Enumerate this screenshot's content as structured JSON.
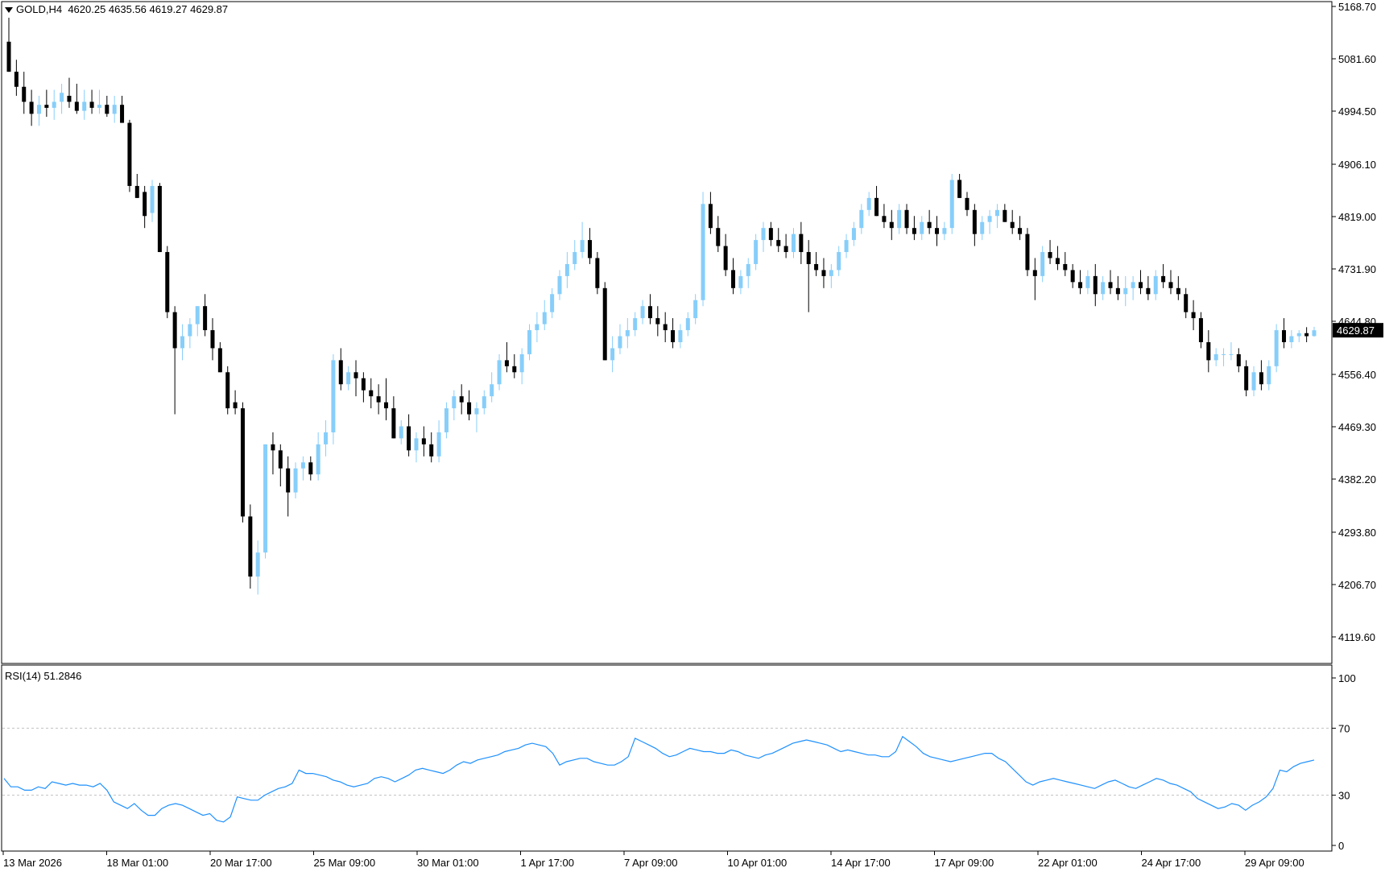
{
  "header": {
    "symbol_timeframe": "GOLD,H4",
    "ohlc_text": "4620.25 4635.56 4619.27 4629.87"
  },
  "price_axis": {
    "ticks": [
      "5168.70",
      "5081.60",
      "4994.50",
      "4906.10",
      "4819.00",
      "4731.90",
      "4644.80",
      "4556.40",
      "4469.30",
      "4382.20",
      "4293.80",
      "4206.70",
      "4119.60"
    ],
    "current_price": "4629.87"
  },
  "rsi": {
    "label": "RSI(14) 51.2846",
    "ticks": [
      "100",
      "70",
      "30",
      "0"
    ]
  },
  "time_axis": {
    "labels": [
      "13 Mar 2026",
      "18 Mar 01:00",
      "20 Mar 17:00",
      "25 Mar 09:00",
      "30 Mar 01:00",
      "1 Apr 17:00",
      "7 Apr 09:00",
      "10 Apr 01:00",
      "14 Apr 17:00",
      "17 Apr 09:00",
      "22 Apr 01:00",
      "24 Apr 17:00",
      "29 Apr 09:00"
    ]
  },
  "colors": {
    "bull": "#87CEFA",
    "bear": "#000000",
    "rsi_line": "#1E90FF",
    "level_line": "#C0C0C0",
    "price_tag_bg": "#000000",
    "price_tag_text": "#FFFFFF"
  },
  "chart_data": [
    {
      "type": "candlestick",
      "title": "GOLD,H4",
      "ylim": [
        4100,
        5180
      ],
      "x_tick_labels": [
        "13 Mar 2026",
        "18 Mar 01:00",
        "20 Mar 17:00",
        "25 Mar 09:00",
        "30 Mar 01:00",
        "1 Apr 17:00",
        "7 Apr 09:00",
        "10 Apr 01:00",
        "14 Apr 17:00",
        "17 Apr 09:00",
        "22 Apr 01:00",
        "24 Apr 17:00",
        "29 Apr 09:00"
      ],
      "ohlc": [
        [
          5110,
          5150,
          5060,
          5060
        ],
        [
          5060,
          5080,
          5020,
          5035
        ],
        [
          5035,
          5060,
          4990,
          5010
        ],
        [
          5010,
          5030,
          4970,
          4990
        ],
        [
          4990,
          5020,
          4970,
          5005
        ],
        [
          5005,
          5030,
          4985,
          5000
        ],
        [
          5000,
          5030,
          4980,
          5010
        ],
        [
          5010,
          5040,
          4990,
          5025
        ],
        [
          5020,
          5050,
          5000,
          5010
        ],
        [
          5010,
          5040,
          4990,
          4995
        ],
        [
          4995,
          5030,
          4980,
          5010
        ],
        [
          5010,
          5030,
          4990,
          5000
        ],
        [
          5000,
          5030,
          4990,
          5005
        ],
        [
          5005,
          5020,
          4985,
          4990
        ],
        [
          4990,
          5020,
          4975,
          5005
        ],
        [
          5005,
          5020,
          4975,
          4975
        ],
        [
          4975,
          4980,
          4860,
          4870
        ],
        [
          4870,
          4890,
          4850,
          4850
        ],
        [
          4860,
          4870,
          4800,
          4820
        ],
        [
          4825,
          4880,
          4810,
          4870
        ],
        [
          4870,
          4875,
          4760,
          4760
        ],
        [
          4760,
          4770,
          4650,
          4660
        ],
        [
          4660,
          4670,
          4490,
          4600
        ],
        [
          4600,
          4640,
          4580,
          4620
        ],
        [
          4620,
          4650,
          4600,
          4640
        ],
        [
          4640,
          4670,
          4620,
          4670
        ],
        [
          4670,
          4690,
          4620,
          4630
        ],
        [
          4630,
          4650,
          4580,
          4600
        ],
        [
          4600,
          4610,
          4560,
          4560
        ],
        [
          4560,
          4570,
          4490,
          4500
        ],
        [
          4510,
          4530,
          4490,
          4500
        ],
        [
          4500,
          4510,
          4310,
          4320
        ],
        [
          4320,
          4340,
          4200,
          4220
        ],
        [
          4220,
          4280,
          4190,
          4260
        ],
        [
          4260,
          4440,
          4250,
          4440
        ],
        [
          4440,
          4460,
          4390,
          4430
        ],
        [
          4430,
          4440,
          4370,
          4400
        ],
        [
          4400,
          4420,
          4320,
          4360
        ],
        [
          4360,
          4410,
          4350,
          4400
        ],
        [
          4400,
          4420,
          4380,
          4410
        ],
        [
          4410,
          4420,
          4380,
          4390
        ],
        [
          4390,
          4460,
          4380,
          4440
        ],
        [
          4440,
          4480,
          4420,
          4460
        ],
        [
          4460,
          4590,
          4440,
          4580
        ],
        [
          4580,
          4600,
          4530,
          4540
        ],
        [
          4540,
          4570,
          4530,
          4560
        ],
        [
          4560,
          4580,
          4520,
          4550
        ],
        [
          4550,
          4560,
          4510,
          4530
        ],
        [
          4530,
          4550,
          4500,
          4520
        ],
        [
          4520,
          4540,
          4490,
          4510
        ],
        [
          4510,
          4550,
          4480,
          4500
        ],
        [
          4500,
          4520,
          4450,
          4450
        ],
        [
          4450,
          4480,
          4440,
          4470
        ],
        [
          4470,
          4490,
          4420,
          4430
        ],
        [
          4430,
          4460,
          4410,
          4450
        ],
        [
          4450,
          4470,
          4420,
          4440
        ],
        [
          4440,
          4460,
          4410,
          4420
        ],
        [
          4420,
          4480,
          4410,
          4460
        ],
        [
          4460,
          4510,
          4450,
          4500
        ],
        [
          4500,
          4530,
          4480,
          4520
        ],
        [
          4520,
          4540,
          4490,
          4510
        ],
        [
          4510,
          4530,
          4480,
          4490
        ],
        [
          4490,
          4510,
          4460,
          4500
        ],
        [
          4500,
          4530,
          4490,
          4520
        ],
        [
          4520,
          4560,
          4510,
          4540
        ],
        [
          4540,
          4590,
          4530,
          4580
        ],
        [
          4580,
          4610,
          4560,
          4570
        ],
        [
          4570,
          4590,
          4550,
          4560
        ],
        [
          4560,
          4600,
          4540,
          4590
        ],
        [
          4590,
          4640,
          4580,
          4630
        ],
        [
          4630,
          4660,
          4610,
          4640
        ],
        [
          4640,
          4680,
          4630,
          4660
        ],
        [
          4660,
          4700,
          4650,
          4690
        ],
        [
          4690,
          4730,
          4680,
          4720
        ],
        [
          4720,
          4760,
          4700,
          4740
        ],
        [
          4740,
          4780,
          4730,
          4760
        ],
        [
          4760,
          4810,
          4750,
          4780
        ],
        [
          4780,
          4800,
          4740,
          4750
        ],
        [
          4750,
          4760,
          4690,
          4700
        ],
        [
          4700,
          4710,
          4580,
          4580
        ],
        [
          4580,
          4620,
          4560,
          4600
        ],
        [
          4600,
          4640,
          4590,
          4620
        ],
        [
          4620,
          4650,
          4600,
          4630
        ],
        [
          4630,
          4660,
          4620,
          4650
        ],
        [
          4650,
          4680,
          4640,
          4670
        ],
        [
          4670,
          4690,
          4640,
          4650
        ],
        [
          4650,
          4670,
          4620,
          4640
        ],
        [
          4640,
          4660,
          4610,
          4630
        ],
        [
          4630,
          4650,
          4600,
          4610
        ],
        [
          4610,
          4640,
          4600,
          4630
        ],
        [
          4630,
          4660,
          4620,
          4650
        ],
        [
          4650,
          4690,
          4640,
          4680
        ],
        [
          4680,
          4860,
          4670,
          4840
        ],
        [
          4840,
          4860,
          4790,
          4800
        ],
        [
          4800,
          4820,
          4760,
          4770
        ],
        [
          4770,
          4790,
          4720,
          4730
        ],
        [
          4730,
          4750,
          4690,
          4700
        ],
        [
          4700,
          4730,
          4690,
          4720
        ],
        [
          4720,
          4750,
          4700,
          4740
        ],
        [
          4740,
          4790,
          4730,
          4780
        ],
        [
          4780,
          4810,
          4760,
          4800
        ],
        [
          4800,
          4810,
          4770,
          4780
        ],
        [
          4780,
          4800,
          4760,
          4770
        ],
        [
          4770,
          4790,
          4750,
          4760
        ],
        [
          4760,
          4800,
          4750,
          4790
        ],
        [
          4790,
          4810,
          4740,
          4760
        ],
        [
          4760,
          4780,
          4660,
          4740
        ],
        [
          4740,
          4760,
          4720,
          4730
        ],
        [
          4730,
          4750,
          4700,
          4720
        ],
        [
          4720,
          4740,
          4700,
          4730
        ],
        [
          4730,
          4770,
          4720,
          4760
        ],
        [
          4760,
          4790,
          4750,
          4780
        ],
        [
          4780,
          4810,
          4770,
          4800
        ],
        [
          4800,
          4840,
          4790,
          4830
        ],
        [
          4830,
          4860,
          4820,
          4850
        ],
        [
          4850,
          4870,
          4820,
          4820
        ],
        [
          4820,
          4840,
          4800,
          4810
        ],
        [
          4810,
          4830,
          4780,
          4800
        ],
        [
          4800,
          4840,
          4790,
          4830
        ],
        [
          4830,
          4840,
          4790,
          4800
        ],
        [
          4800,
          4820,
          4780,
          4790
        ],
        [
          4790,
          4820,
          4780,
          4810
        ],
        [
          4810,
          4830,
          4790,
          4800
        ],
        [
          4800,
          4820,
          4770,
          4790
        ],
        [
          4790,
          4810,
          4780,
          4800
        ],
        [
          4800,
          4890,
          4790,
          4880
        ],
        [
          4880,
          4890,
          4850,
          4850
        ],
        [
          4850,
          4860,
          4820,
          4830
        ],
        [
          4830,
          4840,
          4770,
          4790
        ],
        [
          4790,
          4820,
          4780,
          4810
        ],
        [
          4810,
          4830,
          4790,
          4820
        ],
        [
          4820,
          4840,
          4800,
          4830
        ],
        [
          4830,
          4840,
          4810,
          4810
        ],
        [
          4810,
          4830,
          4790,
          4800
        ],
        [
          4800,
          4820,
          4780,
          4790
        ],
        [
          4790,
          4800,
          4720,
          4730
        ],
        [
          4730,
          4750,
          4680,
          4720
        ],
        [
          4720,
          4770,
          4710,
          4760
        ],
        [
          4760,
          4780,
          4740,
          4750
        ],
        [
          4750,
          4770,
          4730,
          4740
        ],
        [
          4740,
          4760,
          4720,
          4730
        ],
        [
          4730,
          4740,
          4700,
          4710
        ],
        [
          4710,
          4730,
          4690,
          4700
        ],
        [
          4700,
          4730,
          4690,
          4720
        ],
        [
          4720,
          4740,
          4670,
          4690
        ],
        [
          4690,
          4720,
          4680,
          4710
        ],
        [
          4710,
          4730,
          4690,
          4700
        ],
        [
          4700,
          4720,
          4680,
          4690
        ],
        [
          4690,
          4720,
          4670,
          4700
        ],
        [
          4700,
          4720,
          4680,
          4710
        ],
        [
          4710,
          4730,
          4690,
          4700
        ],
        [
          4700,
          4720,
          4680,
          4690
        ],
        [
          4690,
          4730,
          4680,
          4720
        ],
        [
          4720,
          4740,
          4700,
          4710
        ],
        [
          4710,
          4730,
          4690,
          4700
        ],
        [
          4700,
          4720,
          4680,
          4690
        ],
        [
          4690,
          4700,
          4650,
          4660
        ],
        [
          4660,
          4680,
          4630,
          4650
        ],
        [
          4650,
          4660,
          4600,
          4610
        ],
        [
          4610,
          4630,
          4560,
          4580
        ],
        [
          4580,
          4600,
          4570,
          4590
        ],
        [
          4590,
          4600,
          4570,
          4590
        ],
        [
          4590,
          4610,
          4580,
          4590
        ],
        [
          4590,
          4600,
          4560,
          4570
        ],
        [
          4570,
          4580,
          4520,
          4530
        ],
        [
          4530,
          4570,
          4520,
          4560
        ],
        [
          4560,
          4580,
          4530,
          4540
        ],
        [
          4540,
          4580,
          4530,
          4570
        ],
        [
          4570,
          4640,
          4560,
          4630
        ],
        [
          4630,
          4650,
          4600,
          4610
        ],
        [
          4610,
          4630,
          4600,
          4620
        ],
        [
          4620,
          4630,
          4610,
          4625
        ],
        [
          4625,
          4635,
          4610,
          4620
        ],
        [
          4620.25,
          4635.56,
          4619.27,
          4629.87
        ]
      ]
    },
    {
      "type": "line",
      "title": "RSI(14) 51.2846",
      "ylim": [
        0,
        100
      ],
      "levels": [
        70,
        30
      ],
      "series": [
        {
          "values": [
            40,
            35,
            35,
            33,
            33,
            35,
            34,
            38,
            37,
            36,
            37,
            36,
            36,
            35,
            37,
            33,
            26,
            24,
            22,
            25,
            21,
            18,
            18,
            22,
            24,
            25,
            24,
            22,
            20,
            18,
            19,
            15,
            14,
            17,
            29,
            28,
            27,
            27,
            30,
            32,
            34,
            35,
            37,
            45,
            43,
            43,
            42,
            41,
            39,
            38,
            36,
            35,
            36,
            37,
            40,
            41,
            40,
            38,
            40,
            42,
            45,
            46,
            45,
            44,
            43,
            45,
            48,
            50,
            49,
            51,
            52,
            53,
            54,
            56,
            57,
            58,
            60,
            61,
            60,
            59,
            55,
            48,
            50,
            51,
            52,
            52,
            50,
            49,
            48,
            48,
            50,
            53,
            64,
            62,
            60,
            58,
            55,
            53,
            54,
            56,
            58,
            57,
            56,
            56,
            55,
            55,
            57,
            56,
            54,
            53,
            52,
            54,
            55,
            57,
            59,
            61,
            62,
            63,
            62,
            61,
            60,
            58,
            56,
            57,
            56,
            55,
            54,
            54,
            53,
            53,
            56,
            65,
            62,
            59,
            55,
            53,
            52,
            51,
            50,
            51,
            52,
            53,
            54,
            55,
            55,
            52,
            50,
            46,
            42,
            38,
            36,
            38,
            39,
            40,
            39,
            38,
            37,
            36,
            35,
            34,
            36,
            38,
            39,
            37,
            35,
            34,
            36,
            38,
            40,
            39,
            37,
            36,
            34,
            32,
            28,
            26,
            24,
            22,
            23,
            25,
            24,
            21,
            24,
            26,
            29,
            34,
            45,
            44,
            47,
            49,
            50,
            51
          ]
        }
      ]
    }
  ]
}
